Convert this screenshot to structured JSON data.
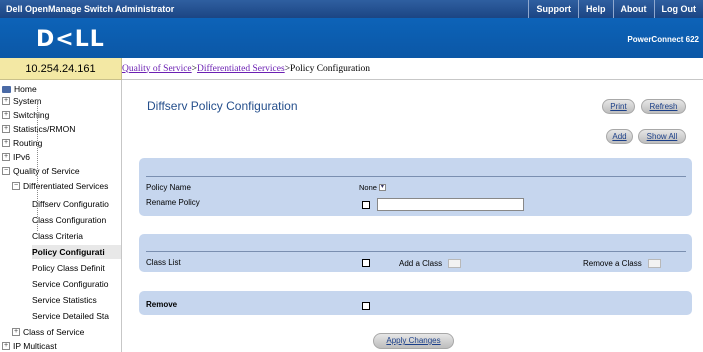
{
  "app_title": "Dell OpenManage Switch Administrator",
  "top_links": [
    "Support",
    "Help",
    "About",
    "Log Out"
  ],
  "logo": "D<LL",
  "product": "PowerConnect 622",
  "ip_address": "10.254.24.161",
  "breadcrumb": {
    "link1": "Quality of Service",
    "sep1": " > ",
    "link2": "Differentiated Services",
    "sep2": " > ",
    "current": "Policy Configuration"
  },
  "nav": {
    "home": "Home",
    "system": "System",
    "switching": "Switching",
    "statistics": "Statistics/RMON",
    "routing": "Routing",
    "ipv6": "IPv6",
    "qos": "Quality of Service",
    "diffserv": "Differentiated Services",
    "sub_items": [
      "Diffserv Configuratio",
      "Class Configuration",
      "Class Criteria",
      "Policy Configurati",
      "Policy Class Definit",
      "Service Configuratio",
      "Service Statistics",
      "Service Detailed Sta"
    ],
    "cos": "Class of Service",
    "ip_multicast": "IP Multicast"
  },
  "page_title": "Diffserv Policy Configuration",
  "buttons": {
    "print": "Print",
    "refresh": "Refresh",
    "add": "Add",
    "show_all": "Show All",
    "apply": "Apply Changes"
  },
  "form": {
    "policy_name_label": "Policy Name",
    "policy_name_value": "None",
    "rename_label": "Rename Policy",
    "rename_value": "",
    "class_list_label": "Class List",
    "add_class_label": "Add a Class",
    "remove_class_label": "Remove a Class",
    "remove_label": "Remove"
  }
}
